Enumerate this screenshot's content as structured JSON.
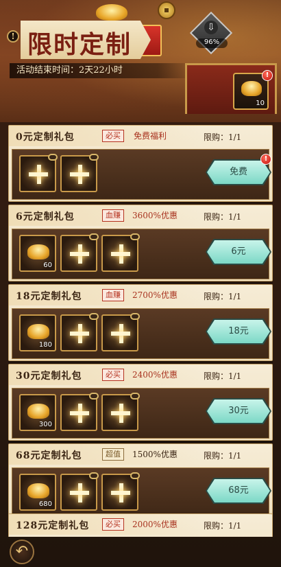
{
  "header": {
    "title": "限时定制",
    "countdown": "活动结束时间：2天22小时",
    "progress_percent": "96%",
    "side_item_qty": "10",
    "alert_mark": "!",
    "info_mark": "!"
  },
  "packages": [
    {
      "name": "0元定制礼包",
      "tag": "必买",
      "desc": "免费福利",
      "limit": "限购：1/1",
      "price": "免费",
      "items": [
        {
          "type": "mystery"
        },
        {
          "type": "mystery"
        }
      ],
      "has_alert": true
    },
    {
      "name": "6元定制礼包",
      "tag": "血赚",
      "desc": "3600%优惠",
      "limit": "限购：1/1",
      "price": "6元",
      "items": [
        {
          "type": "ingot",
          "qty": "60"
        },
        {
          "type": "mystery"
        },
        {
          "type": "mystery"
        }
      ]
    },
    {
      "name": "18元定制礼包",
      "tag": "血赚",
      "desc": "2700%优惠",
      "limit": "限购：1/1",
      "price": "18元",
      "items": [
        {
          "type": "ingot",
          "qty": "180"
        },
        {
          "type": "mystery"
        },
        {
          "type": "mystery"
        }
      ]
    },
    {
      "name": "30元定制礼包",
      "tag": "必买",
      "desc": "2400%优惠",
      "limit": "限购：1/1",
      "price": "30元",
      "items": [
        {
          "type": "ingot",
          "qty": "300"
        },
        {
          "type": "mystery"
        },
        {
          "type": "mystery"
        }
      ]
    },
    {
      "name": "68元定制礼包",
      "tag": "超值",
      "desc": "1500%优惠",
      "limit": "限购：1/1",
      "price": "68元",
      "items": [
        {
          "type": "ingot",
          "qty": "680"
        },
        {
          "type": "mystery"
        },
        {
          "type": "mystery"
        }
      ]
    },
    {
      "name": "128元定制礼包",
      "tag": "必买",
      "desc": "2000%优惠",
      "limit": "限购：1/1",
      "price": "",
      "items": []
    }
  ],
  "footer": {
    "back_icon": "back-arrow-icon",
    "back_glyph": "↶"
  },
  "colors": {
    "accent_red": "#b5321f",
    "button_teal": "#7cd8c6",
    "panel_cream": "#f6ecd6"
  }
}
